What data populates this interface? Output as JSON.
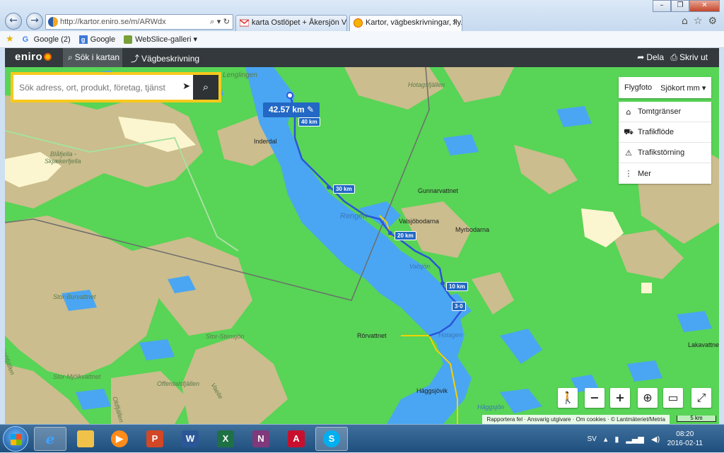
{
  "browser": {
    "url": "http://kartor.eniro.se/m/ARWdx",
    "tabs": [
      {
        "label": "karta Ostlöpet + Åkersjön Verti..."
      },
      {
        "label": "Kartor, vägbeskrivningar, fly..."
      }
    ],
    "favorites": [
      {
        "label": "Google (2)"
      },
      {
        "label": "Google"
      },
      {
        "label": "WebSlice-galleri ▾"
      }
    ]
  },
  "app": {
    "logo": "eniro",
    "nav": {
      "search": "Sök i kartan",
      "directions": "Vägbeskrivning",
      "share": "Dela",
      "print": "Skriv ut"
    }
  },
  "map": {
    "search_placeholder": "Sök adress, ort, produkt, företag, tjänst",
    "route_distance": "42.57 km",
    "km_markers": [
      "40 km",
      "30 km",
      "20 km",
      "10 km",
      "3·0"
    ],
    "layer_buttons": {
      "aerial": "Flygfoto",
      "chart": "Sjökort mm ▾"
    },
    "layers": [
      {
        "label": "Tomtgränser",
        "icon": "property-lines-icon"
      },
      {
        "label": "Trafikflöde",
        "icon": "car-icon"
      },
      {
        "label": "Trafikstörning",
        "icon": "warning-icon"
      },
      {
        "label": "Mer",
        "icon": "more-icon"
      }
    ],
    "place_labels": {
      "lenglingen": "Lenglingen",
      "hotagsfjallen": "Hotagsfjällen",
      "inderdal": "Inderdal",
      "blafjella": "Blåfjella -",
      "skjaekerfjella": "Skjækerfjella",
      "gunnarvattnet": "Gunnarvattnet",
      "rengen": "Rengen",
      "valsjobodarna": "Valsjöbodarna",
      "myrbodarna": "Myrbodarna",
      "valsjon": "Valsjön",
      "stor_burvattnet": "Stor-Burvattnet",
      "rorvattnet": "Rörvattnet",
      "hotagen": "Hotagen",
      "stor_stensjon": "Stor-Stensjön",
      "lakavattnet": "Lakavattnet",
      "sosjofjallen": "Sösjöfjällen",
      "stor_mjolkvattnet": "Stor-Mjölkvattnet",
      "offerdalsfjallen": "Offerdalsfjällen",
      "vaelie": "Vaelie",
      "oldfjallen": "Oldfjällen",
      "haggsjovik": "Häggsjövik",
      "haggsjon": "Häggsjön"
    },
    "attribution": "Rapportera fel · Ansvarig utgivare · Om cookies · © Lantmäteriet/Metria",
    "scale": "5 km"
  },
  "taskbar": {
    "apps": [
      "Internet Explorer",
      "File Explorer",
      "Media Player",
      "PowerPoint",
      "Word",
      "Excel",
      "OneNote",
      "Acrobat",
      "Skype"
    ],
    "language": "SV",
    "time": "08:20",
    "date": "2016-02-11"
  }
}
